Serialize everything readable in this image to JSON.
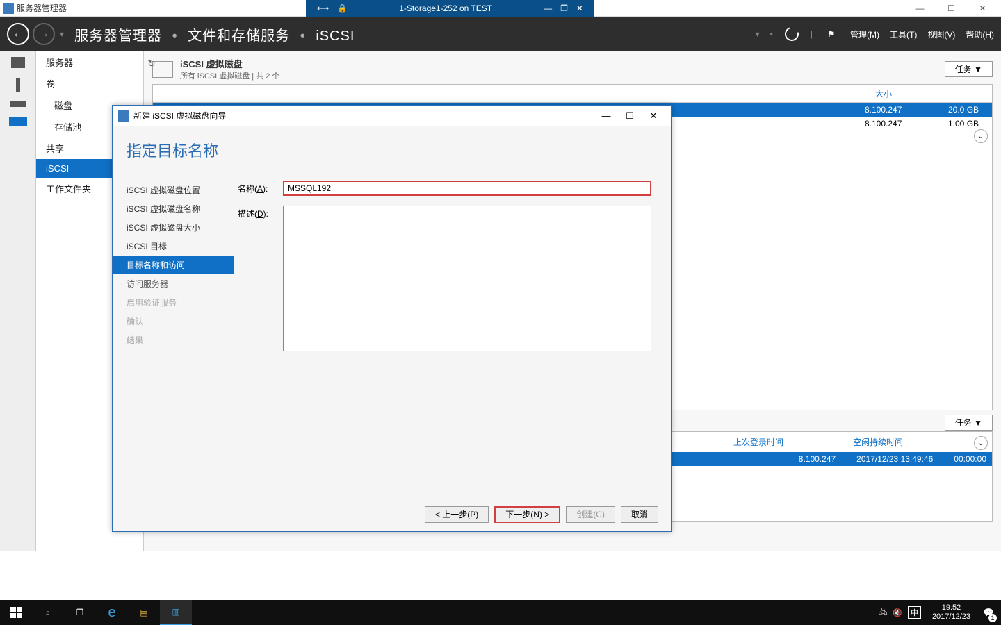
{
  "outer_title": "服务器管理器",
  "remote": {
    "title": "1-Storage1-252 on TEST"
  },
  "breadcrumb": {
    "root": "服务器管理器",
    "mid": "文件和存储服务",
    "leaf": "iSCSI"
  },
  "header_menu": {
    "manage": "管理(M)",
    "tools": "工具(T)",
    "view": "视图(V)",
    "help": "帮助(H)"
  },
  "sidebar": {
    "items": [
      "服务器",
      "卷",
      "磁盘",
      "存储池",
      "共享",
      "iSCSI",
      "工作文件夹"
    ]
  },
  "panel": {
    "title1": "iSCSI 虚拟磁盘",
    "title2": "所有 iSCSI 虚拟磁盘 | 共 2 个",
    "tasks": "任务",
    "columns": {
      "size": "大小"
    },
    "rows": [
      {
        "ip": "8.100.247",
        "size": "20.0 GB"
      },
      {
        "ip": "8.100.247",
        "size": "1.00 GB"
      }
    ]
  },
  "lower": {
    "tasks": "任务",
    "columns": {
      "last": "上次登录时间",
      "idle": "空闲持续时间"
    },
    "row": {
      "ip": "8.100.247",
      "date": "2017/12/23 13:49:46",
      "idle": "00:00:00"
    }
  },
  "wizard": {
    "title": "新建 iSCSI 虚拟磁盘向导",
    "heading": "指定目标名称",
    "steps": [
      "iSCSI 虚拟磁盘位置",
      "iSCSI 虚拟磁盘名称",
      "iSCSI 虚拟磁盘大小",
      "iSCSI 目标",
      "目标名称和访问",
      "访问服务器",
      "启用验证服务",
      "确认",
      "结果"
    ],
    "name_label": "名称(",
    "name_key": "A",
    "name_label_end": "):",
    "name_value": "MSSQL192",
    "desc_label": "描述(",
    "desc_key": "D",
    "desc_label_end": "):",
    "desc_value": "",
    "buttons": {
      "prev": "< 上一步(P)",
      "next": "下一步(N) >",
      "create": "创建(C)",
      "cancel": "取消"
    }
  },
  "taskbar": {
    "ime": "中",
    "time": "19:52",
    "date": "2017/12/23",
    "notif_count": "1"
  }
}
